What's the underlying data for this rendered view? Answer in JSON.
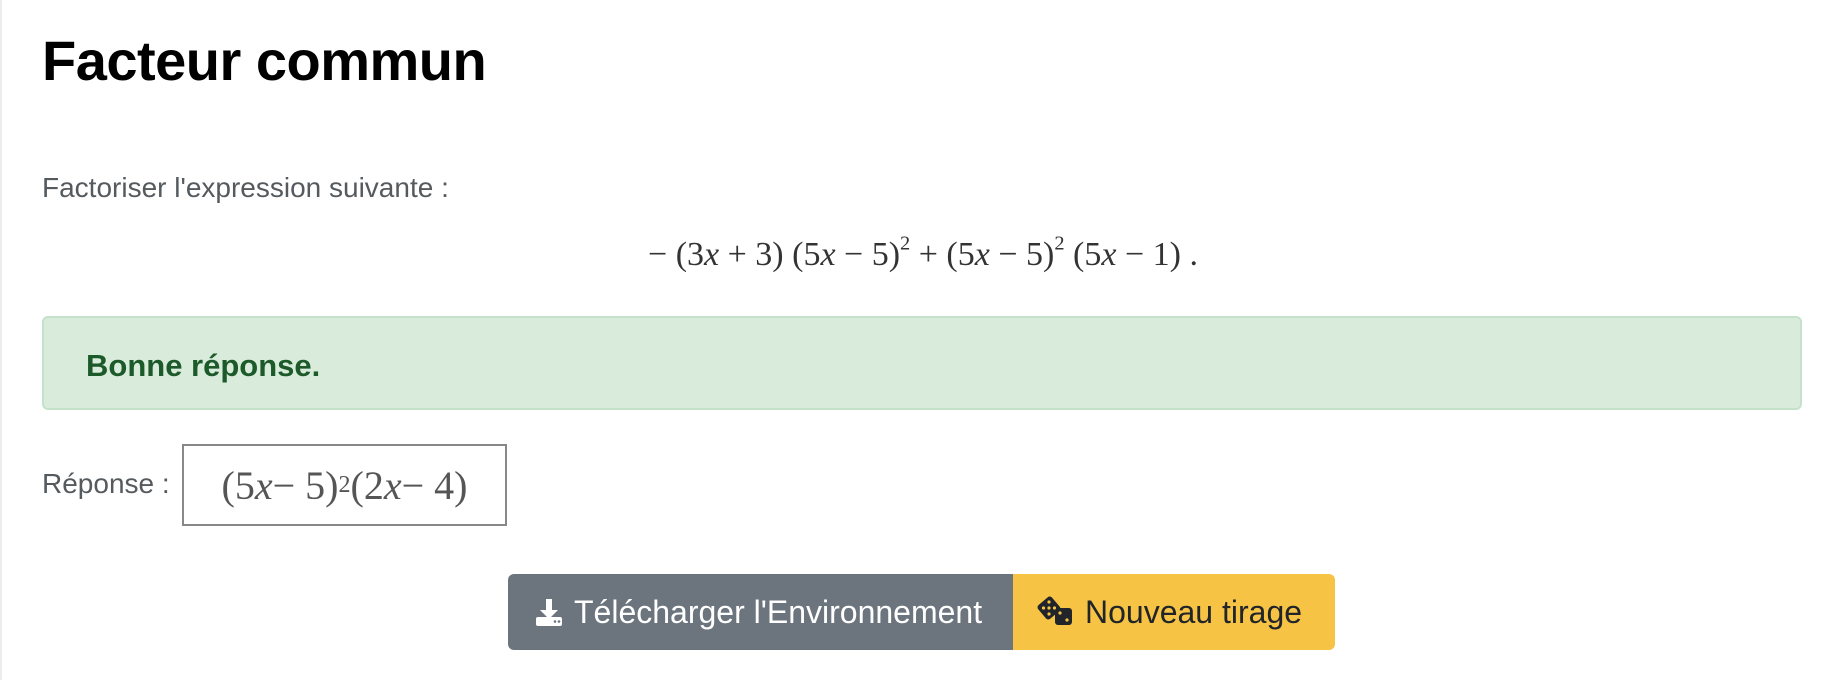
{
  "page": {
    "title": "Facteur commun",
    "prompt": "Factoriser l'expression suivante :"
  },
  "expression": {
    "p1": "− (3",
    "v1": "x",
    "p2": " + 3) (5",
    "v2": "x",
    "p3": " − 5)",
    "e1": "2",
    "p4": " + (5",
    "v3": "x",
    "p5": " − 5)",
    "e2": "2",
    "p6": " (5",
    "v4": "x",
    "p7": " − 1) ."
  },
  "feedback": {
    "message": "Bonne réponse.",
    "status_color": "#1d5a2a"
  },
  "answer": {
    "label": "Réponse :",
    "p1": "(5",
    "v1": "x",
    "p2": " − 5)",
    "e1": "2",
    "p3": "(2",
    "v2": "x",
    "p4": " − 4)"
  },
  "buttons": {
    "download": {
      "label": "Télécharger l'Environnement",
      "icon": "download-icon",
      "color": "#6c757d"
    },
    "new_draw": {
      "label": "Nouveau tirage",
      "icon": "dice-icon",
      "color": "#f6c344"
    }
  }
}
